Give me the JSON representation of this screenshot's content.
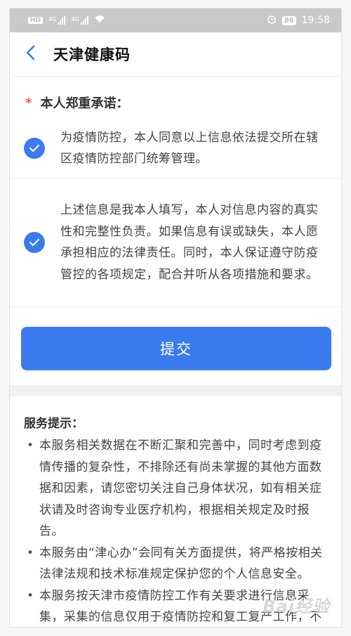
{
  "status_bar": {
    "hd_label": "HD",
    "signal1_tag": "4G",
    "signal2_tag": "4G",
    "battery_level": "86",
    "time": "19:58"
  },
  "header": {
    "back_icon": "chevron-left-icon",
    "title": "天津健康码"
  },
  "commitment": {
    "required_mark": "*",
    "heading": "本人郑重承诺：",
    "items": [
      {
        "checked": true,
        "text": "为疫情防控，本人同意以上信息依法提交所在辖区疫情防控部门统筹管理。"
      },
      {
        "checked": true,
        "text": "上述信息是我本人填写，本人对信息内容的真实性和完整性负责。如果信息有误或缺失，本人愿承担相应的法律责任。同时，本人保证遵守防疫管控的各项规定，配合并听从各项措施和要求。"
      }
    ]
  },
  "submit_label": "提交",
  "service_tips": {
    "title": "服务提示：",
    "items": [
      "本服务相关数据在不断汇聚和完善中，同时考虑到疫情传播的复杂性，不排除还有尚未掌握的其他方面数据和因素，请您密切关注自己身体状况，如有相关症状请及时咨询专业医疗机构，根据相关规定及时报告。",
      "本服务由“津心办”会同有关方面提供，将严格按相关法律法规和技术标准规定保护您的个人信息安全。",
      "本服务按天津市疫情防控工作有关要求进行信息采集，采集的信息仅用于疫情防控和复工复产工作，不用作其他用途。"
    ]
  },
  "watermark": "Bai经验",
  "colors": {
    "accent": "#3a7cf0",
    "required": "#ff5a36",
    "status_bar": "#c9c9c9"
  }
}
